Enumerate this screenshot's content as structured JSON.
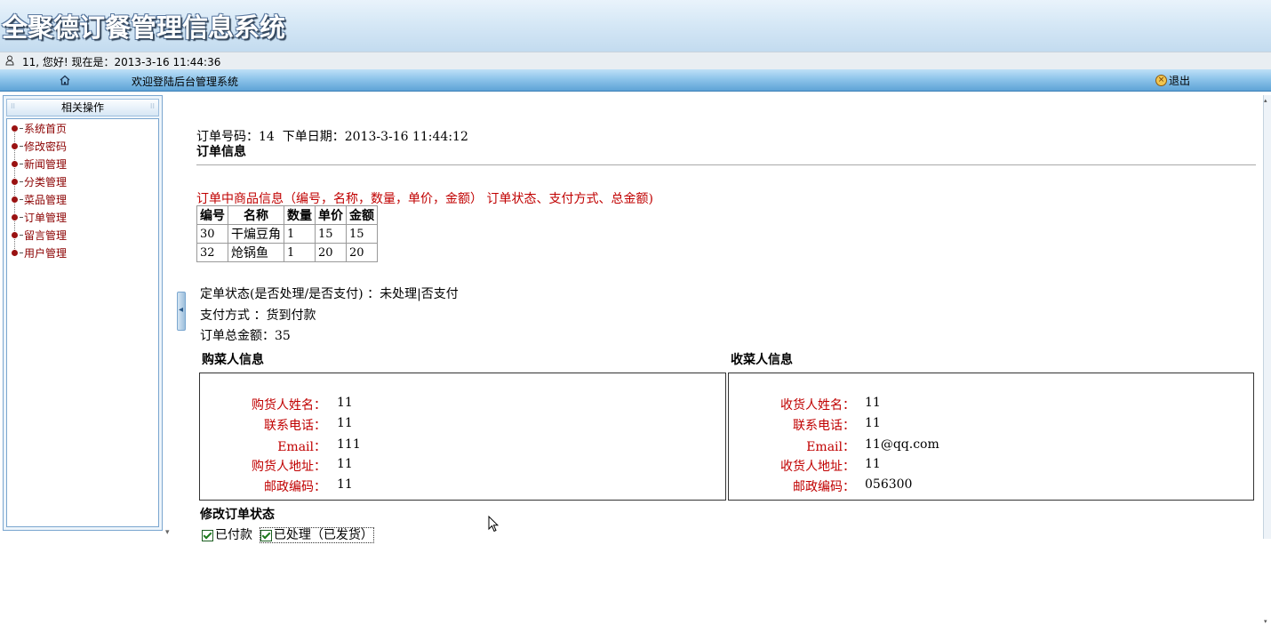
{
  "header": {
    "title": "全聚德订餐管理信息系统"
  },
  "userbar": {
    "greeting": "11, 您好! 现在是：2013-3-16 11:44:36"
  },
  "navbar": {
    "welcome": "欢迎登陆后台管理系统",
    "logout": "退出"
  },
  "sidebar": {
    "heading": "相关操作",
    "items": [
      {
        "label": "系统首页"
      },
      {
        "label": "修改密码"
      },
      {
        "label": "新闻管理"
      },
      {
        "label": "分类管理"
      },
      {
        "label": "菜品管理"
      },
      {
        "label": "订单管理"
      },
      {
        "label": "留言管理"
      },
      {
        "label": "用户管理"
      }
    ]
  },
  "order": {
    "number_label": "订单号码：",
    "number": "14",
    "date_label": "下单日期：",
    "date": "2013-3-16 11:44:12",
    "info_title": "订单信息",
    "items_caption": "订单中商品信息（编号，名称，数量，单价，金额）  订单状态、支付方式、总金额)",
    "table": {
      "headers": [
        "编号",
        "名称",
        "数量",
        "单价",
        "金额"
      ],
      "rows": [
        [
          "30",
          "干煸豆角",
          "1",
          "15",
          "15"
        ],
        [
          "32",
          "炝锅鱼",
          "1",
          "20",
          "20"
        ]
      ]
    },
    "status_line": "定单状态(是否处理/是否支付) ：未处理|否支付",
    "payment_line": "支付方式 ：货到付款",
    "total_line": "订单总金额：35",
    "buyer": {
      "title": "购菜人信息",
      "fields": [
        {
          "label": "购货人姓名：",
          "value": "11"
        },
        {
          "label": "联系电话：",
          "value": "11"
        },
        {
          "label": "Email：",
          "value": "111"
        },
        {
          "label": "购货人地址：",
          "value": "11"
        },
        {
          "label": "邮政编码：",
          "value": "11"
        }
      ]
    },
    "receiver": {
      "title": "收菜人信息",
      "fields": [
        {
          "label": "收货人姓名：",
          "value": "11"
        },
        {
          "label": "联系电话：",
          "value": "11"
        },
        {
          "label": "Email：",
          "value": "11@qq.com"
        },
        {
          "label": "收货人地址：",
          "value": "11"
        },
        {
          "label": "邮政编码：",
          "value": "056300"
        }
      ]
    },
    "modify_title": "修改订单状态",
    "checkbox_paid": "已付款",
    "checkbox_processed": "已处理（已发货）",
    "paid_checked": true,
    "processed_checked": true
  }
}
